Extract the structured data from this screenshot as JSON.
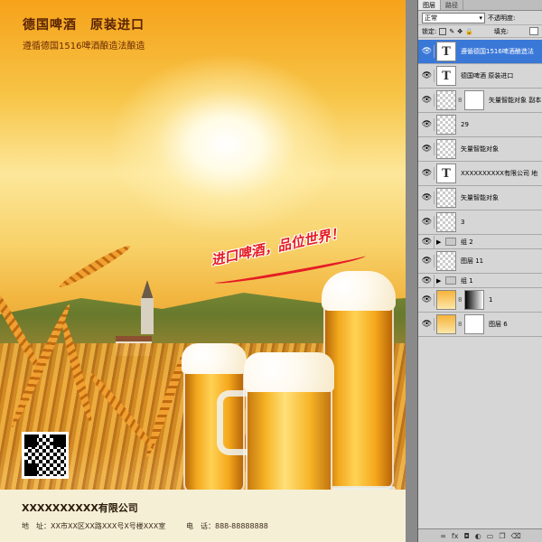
{
  "poster": {
    "title": "德国啤酒　原装进口",
    "subtitle": "遵循德国1516啤酒酿造法酿造",
    "slogan": "进口啤酒，品位世界！",
    "company": "XXXXXXXXXX有限公司",
    "address": "地　址：XX市XX区XX路XXX号X号楼XXX室",
    "phone": "电　话：888-88888888"
  },
  "panel": {
    "tabs": [
      "图层",
      "路径"
    ],
    "blend_mode": "正常",
    "opacity_label": "不透明度:",
    "lock_label": "锁定:",
    "fill_label": "填充:",
    "layers": [
      {
        "name": "遵循德国1516啤酒酿造法",
        "type": "text",
        "selected": true
      },
      {
        "name": "德国啤酒  原装进口",
        "type": "text"
      },
      {
        "name": "矢量智能对象 副本",
        "type": "smart-mask"
      },
      {
        "name": "29",
        "type": "pixel"
      },
      {
        "name": "矢量智能对象",
        "type": "pixel"
      },
      {
        "name": "XXXXXXXXXX有限公司 地",
        "type": "text"
      },
      {
        "name": "矢量智能对象",
        "type": "smart"
      },
      {
        "name": "3",
        "type": "pixel"
      },
      {
        "name": "组 2",
        "type": "group"
      },
      {
        "name": "图层 11",
        "type": "pixel"
      },
      {
        "name": "组 1",
        "type": "group"
      },
      {
        "name": "1",
        "type": "image-mask"
      },
      {
        "name": "图层 6",
        "type": "photo-mask"
      }
    ],
    "bottom_icons": [
      "link-icon",
      "fx-icon",
      "mask-icon",
      "adjustment-icon",
      "folder-icon",
      "new-layer-icon",
      "trash-icon"
    ]
  }
}
